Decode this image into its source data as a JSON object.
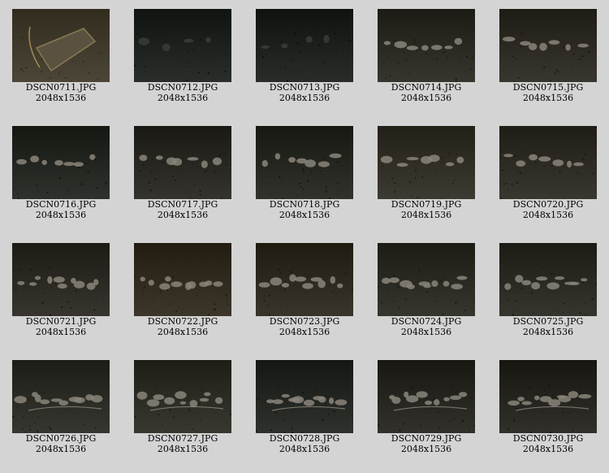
{
  "photos": [
    {
      "name": "DSCN0711.JPG",
      "dims": "2048x1536",
      "scene": "bucket",
      "tone": "#3a3426"
    },
    {
      "name": "DSCN0712.JPG",
      "dims": "2048x1536",
      "scene": "dark",
      "tone": "#181c18"
    },
    {
      "name": "DSCN0713.JPG",
      "dims": "2048x1536",
      "scene": "dark",
      "tone": "#171a16"
    },
    {
      "name": "DSCN0714.JPG",
      "dims": "2048x1536",
      "scene": "bones",
      "tone": "#24231c"
    },
    {
      "name": "DSCN0715.JPG",
      "dims": "2048x1536",
      "scene": "bones",
      "tone": "#26241c"
    },
    {
      "name": "DSCN0716.JPG",
      "dims": "2048x1536",
      "scene": "bones",
      "tone": "#1d1f1a"
    },
    {
      "name": "DSCN0717.JPG",
      "dims": "2048x1536",
      "scene": "bones",
      "tone": "#22211b"
    },
    {
      "name": "DSCN0718.JPG",
      "dims": "2048x1536",
      "scene": "bones",
      "tone": "#1f201a"
    },
    {
      "name": "DSCN0719.JPG",
      "dims": "2048x1536",
      "scene": "bones",
      "tone": "#2b291f"
    },
    {
      "name": "DSCN0720.JPG",
      "dims": "2048x1536",
      "scene": "bones",
      "tone": "#27251d"
    },
    {
      "name": "DSCN0721.JPG",
      "dims": "2048x1536",
      "scene": "skeleton",
      "tone": "#25231c"
    },
    {
      "name": "DSCN0722.JPG",
      "dims": "2048x1536",
      "scene": "skeleton",
      "tone": "#2a2419"
    },
    {
      "name": "DSCN0723.JPG",
      "dims": "2048x1536",
      "scene": "skeleton",
      "tone": "#272319"
    },
    {
      "name": "DSCN0724.JPG",
      "dims": "2048x1536",
      "scene": "skeleton",
      "tone": "#25241c"
    },
    {
      "name": "DSCN0725.JPG",
      "dims": "2048x1536",
      "scene": "skeleton",
      "tone": "#24231c"
    },
    {
      "name": "DSCN0726.JPG",
      "dims": "2048x1536",
      "scene": "row",
      "tone": "#24251e"
    },
    {
      "name": "DSCN0727.JPG",
      "dims": "2048x1536",
      "scene": "row",
      "tone": "#26261e"
    },
    {
      "name": "DSCN0728.JPG",
      "dims": "2048x1536",
      "scene": "row",
      "tone": "#1d1f1b"
    },
    {
      "name": "DSCN0729.JPG",
      "dims": "2048x1536",
      "scene": "row",
      "tone": "#201f1a"
    },
    {
      "name": "DSCN0730.JPG",
      "dims": "2048x1536",
      "scene": "row",
      "tone": "#1f1e19"
    }
  ]
}
